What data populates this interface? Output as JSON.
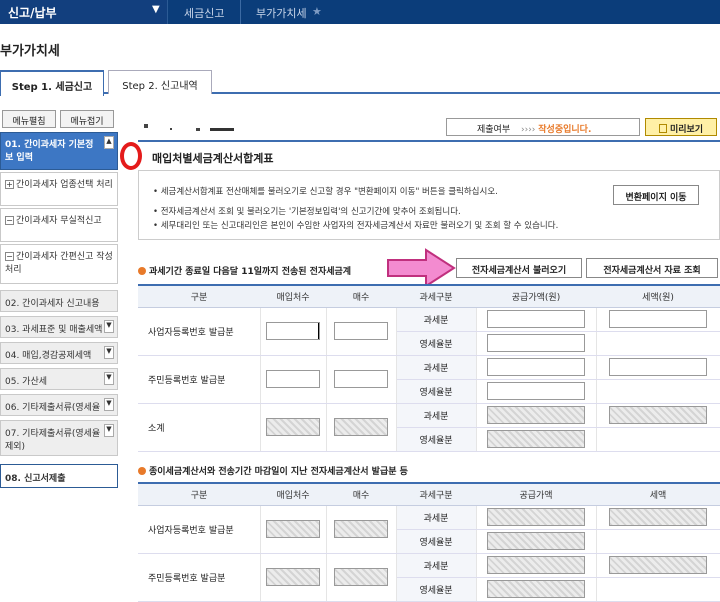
{
  "topbar": {
    "menu_label": "신고/납부",
    "crumb1": "세금신고",
    "crumb2": "부가가치세"
  },
  "page_title": "부가가치세",
  "tabs": [
    "Step 1. 세금신고",
    "Step 2. 신고내역"
  ],
  "sidebar_buttons": [
    "메뉴펼침",
    "메뉴접기"
  ],
  "sidebar": {
    "header": "01. 간이과세자 기본정보 입력",
    "subitems": [
      "간이과세자 업종선택 처리",
      "간이과세자 무실적신고",
      "간이과세자 간편신고 작성 처리"
    ],
    "items": [
      "02. 간이과세자 신고내용",
      "03. 과세표준 및 매출세액",
      "04. 매입,경감공제세액",
      "05. 가산세",
      "06. 기타제출서류(영세율",
      "07. 기타제출서류(영세율 제외)"
    ],
    "final": "08. 신고서제출"
  },
  "status": {
    "label": "제출여부",
    "arrows": "›››› ",
    "state": "작성중입니다."
  },
  "preview_label": "미리보기",
  "section1_title": "매입처별세금계산서합계표",
  "info_lines": [
    "세금계산서합계표 전산매체를 불러오기로 신고할 경우 \"변환페이지 이동\" 버튼을 클릭하십시오.",
    "전자세금계산서 조회 및 불러오기는 '기본정보입력'의 신고기간에 맞추어 조회됩니다.",
    "세무대리인 또는 신고대리인은 본인이 수임한 사업자의 전자세금계산서 자료만 불러오기 및 조회 할 수 있습니다."
  ],
  "convert_button": "변환페이지 이동",
  "section2_title": "과세기간 종료일 다음달 11일까지 전송된 전자세금계",
  "load_button": "전자세금계산서 불러오기",
  "inquiry_button": "전자세금계산서 자료 조회",
  "table1": {
    "headers": [
      "구분",
      "매입처수",
      "매수",
      "과세구분",
      "공급가액(원)",
      "세액(원)"
    ],
    "rows": [
      "사업자등록번호 발급분",
      "주민등록번호 발급분",
      "소계"
    ],
    "kinds": [
      "과세분",
      "영세율분"
    ]
  },
  "section3_title": "종이세금계산서와 전송기간 마감일이 지난 전자세금계산서 발급분 등",
  "table2": {
    "headers": [
      "구분",
      "매입처수",
      "매수",
      "과세구분",
      "공급가액",
      "세액"
    ],
    "rows": [
      "사업자등록번호 발급분",
      "주민등록번호 발급분"
    ],
    "kinds": [
      "과세분",
      "영세율분"
    ]
  }
}
